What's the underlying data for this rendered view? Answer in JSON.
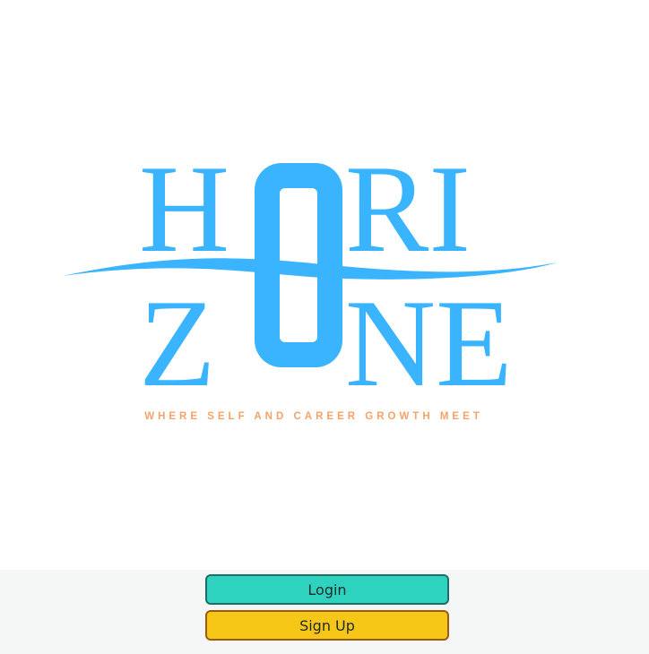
{
  "logo": {
    "line1": "HORI",
    "line2": "ZONE",
    "tagline": "WHERE SELF AND CAREER GROWTH MEET",
    "primary_color": "#3bb4ff",
    "tagline_color": "#f5a36a"
  },
  "actions": {
    "login_label": "Login",
    "signup_label": "Sign Up",
    "login_color": "#2ed3c0",
    "signup_color": "#f7c718"
  }
}
